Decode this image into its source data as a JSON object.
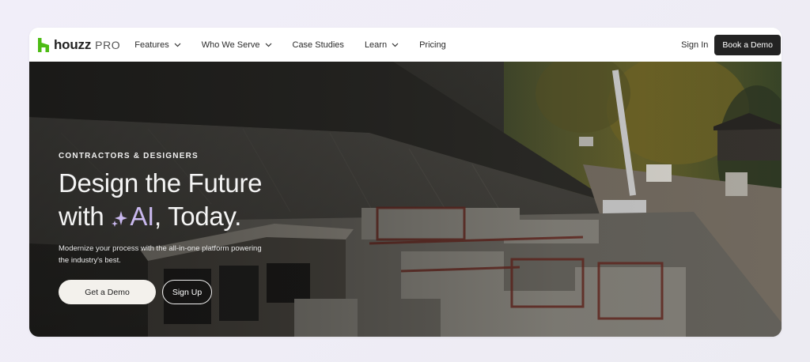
{
  "brand": {
    "name": "houzz",
    "suffix": "PRO",
    "accent": "#4dbc15"
  },
  "nav": {
    "links": [
      {
        "label": "Features",
        "dropdown": true
      },
      {
        "label": "Who We Serve",
        "dropdown": true
      },
      {
        "label": "Case Studies",
        "dropdown": false
      },
      {
        "label": "Learn",
        "dropdown": true
      },
      {
        "label": "Pricing",
        "dropdown": false
      }
    ],
    "sign_in": "Sign In",
    "book_demo": "Book a Demo"
  },
  "hero": {
    "eyebrow": "CONTRACTORS & DESIGNERS",
    "headline_line1": "Design the Future",
    "headline_with": "with ",
    "headline_ai": "AI",
    "headline_end": ", Today.",
    "subtext": "Modernize your process with the all-in-one platform powering the industry's best.",
    "cta_primary": "Get a Demo",
    "cta_secondary": "Sign Up",
    "ai_color": "#c9b8ee",
    "background_image": "construction-site-photo"
  }
}
